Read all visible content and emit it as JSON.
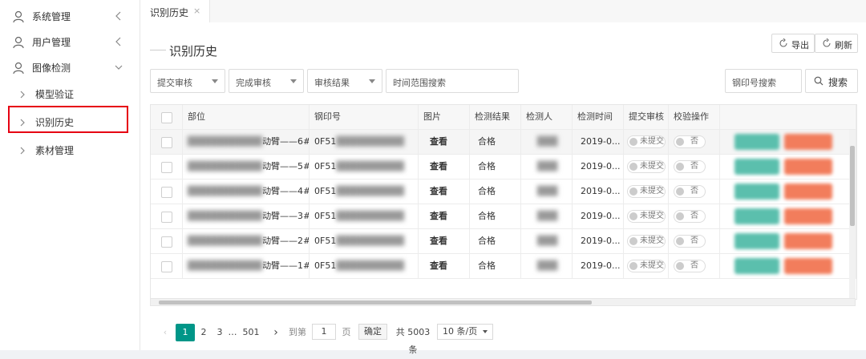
{
  "sidebar": {
    "items": [
      {
        "label": "系统管理",
        "icon": "user-icon"
      },
      {
        "label": "用户管理",
        "icon": "user-icon"
      },
      {
        "label": "图像检测",
        "icon": "user-icon"
      }
    ],
    "sub_items": [
      {
        "label": "模型验证"
      },
      {
        "label": "识别历史"
      },
      {
        "label": "素材管理"
      }
    ],
    "highlight_color": "#e60012"
  },
  "tab": {
    "label": "识别历史",
    "close": "×"
  },
  "page": {
    "title": "识别历史"
  },
  "toolbar": {
    "export_label": "导出",
    "refresh_label": "刷新"
  },
  "filters": {
    "submit_review": "提交审核",
    "complete_review": "完成审核",
    "review_result": "审核结果",
    "time_range": "时间范围搜索",
    "seal_search": "钢印号搜索",
    "search_button": "搜索"
  },
  "table": {
    "headers": [
      "部位",
      "钢印号",
      "图片",
      "检测结果",
      "检测人",
      "检测时间",
      "提交审核",
      "校验操作"
    ],
    "rows": [
      {
        "part": "动臂——6#",
        "seal": "0F51",
        "image": "查看",
        "result": "合格",
        "time": "2019-0...",
        "submit": "未提交",
        "verify": "否"
      },
      {
        "part": "动臂——5#",
        "seal": "0F51",
        "image": "查看",
        "result": "合格",
        "time": "2019-0...",
        "submit": "未提交",
        "verify": "否"
      },
      {
        "part": "动臂——4#",
        "seal": "0F51",
        "image": "查看",
        "result": "合格",
        "time": "2019-0...",
        "submit": "未提交",
        "verify": "否"
      },
      {
        "part": "动臂——3#",
        "seal": "0F51",
        "image": "查看",
        "result": "合格",
        "time": "2019-0...",
        "submit": "未提交",
        "verify": "否"
      },
      {
        "part": "动臂——2#",
        "seal": "0F51",
        "image": "查看",
        "result": "合格",
        "time": "2019-0...",
        "submit": "未提交",
        "verify": "否"
      },
      {
        "part": "动臂——1#",
        "seal": "0F51",
        "image": "查看",
        "result": "合格",
        "time": "2019-0...",
        "submit": "未提交",
        "verify": "否"
      }
    ],
    "action_colors": {
      "primary": "#5bbfad",
      "danger": "#f27d5c"
    }
  },
  "pager": {
    "pages": [
      "1",
      "2",
      "3",
      "…",
      "501"
    ],
    "goto_label": "到第",
    "goto_value": "1",
    "page_unit": "页",
    "confirm": "确定",
    "total": "共 5003 条",
    "page_size": "10 条/页"
  }
}
